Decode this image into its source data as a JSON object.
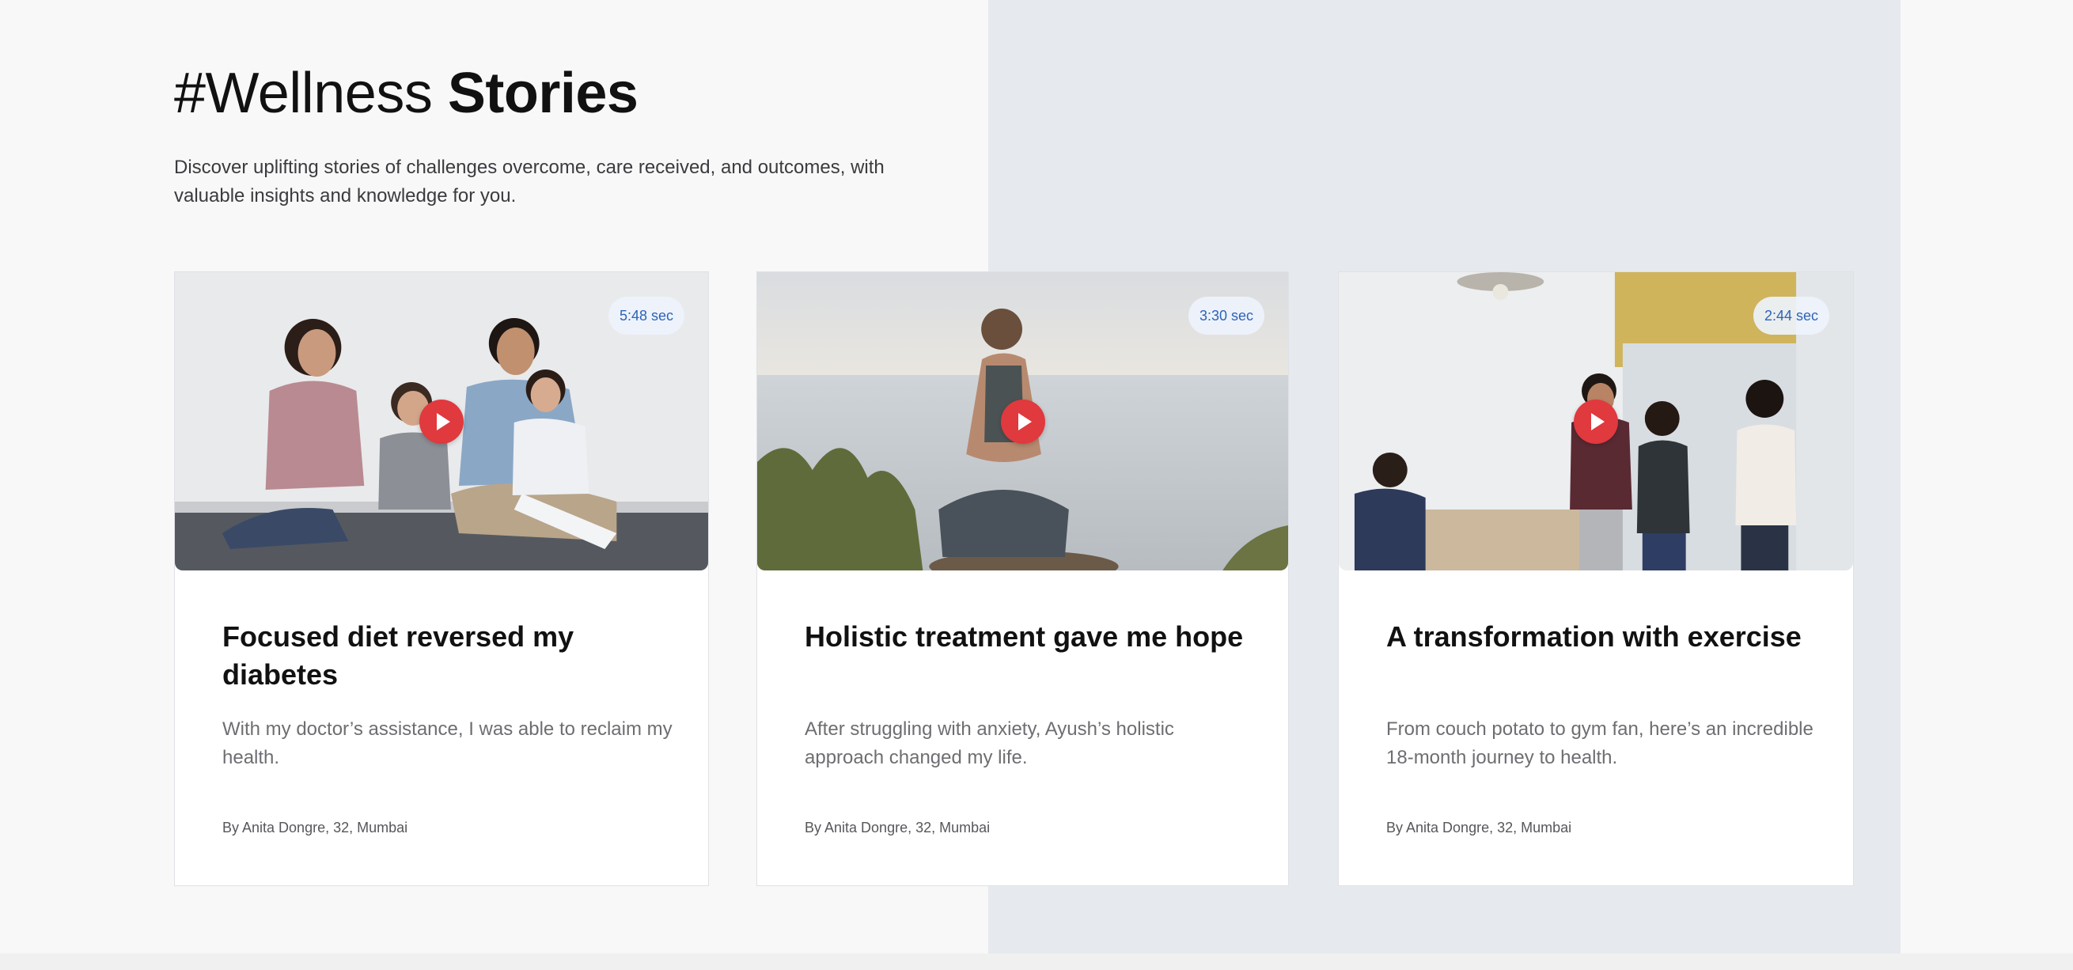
{
  "section": {
    "title_prefix": "#Wellness",
    "title_emphasis": "Stories",
    "intro": "Discover uplifting stories of challenges overcome, care received, and outcomes, with valuable insights and knowledge for you."
  },
  "stories": [
    {
      "title": "Focused diet reversed my diabetes",
      "description": "With my doctor’s assistance, I was able to reclaim my health.",
      "author": "By Anita Dongre, 32, Mumbai",
      "duration": "5:48 sec",
      "image": "family-photo"
    },
    {
      "title": "Holistic treatment gave me hope",
      "description": "After struggling with anxiety, Ayush’s holistic approach changed my life.",
      "author": "By Anita Dongre, 32, Mumbai",
      "duration": "3:30 sec",
      "image": "yoga-by-sea-photo"
    },
    {
      "title": "A transformation with exercise",
      "description": "From couch potato to gym fan, here’s an incredible 18-month journey to health.",
      "author": "By Anita Dongre, 32, Mumbai",
      "duration": "2:44 sec",
      "image": "office-group-photo"
    }
  ],
  "colors": {
    "accent_play": "#e0393e",
    "duration_text": "#2c63b8",
    "panel_bg": "#e6e9ed"
  }
}
